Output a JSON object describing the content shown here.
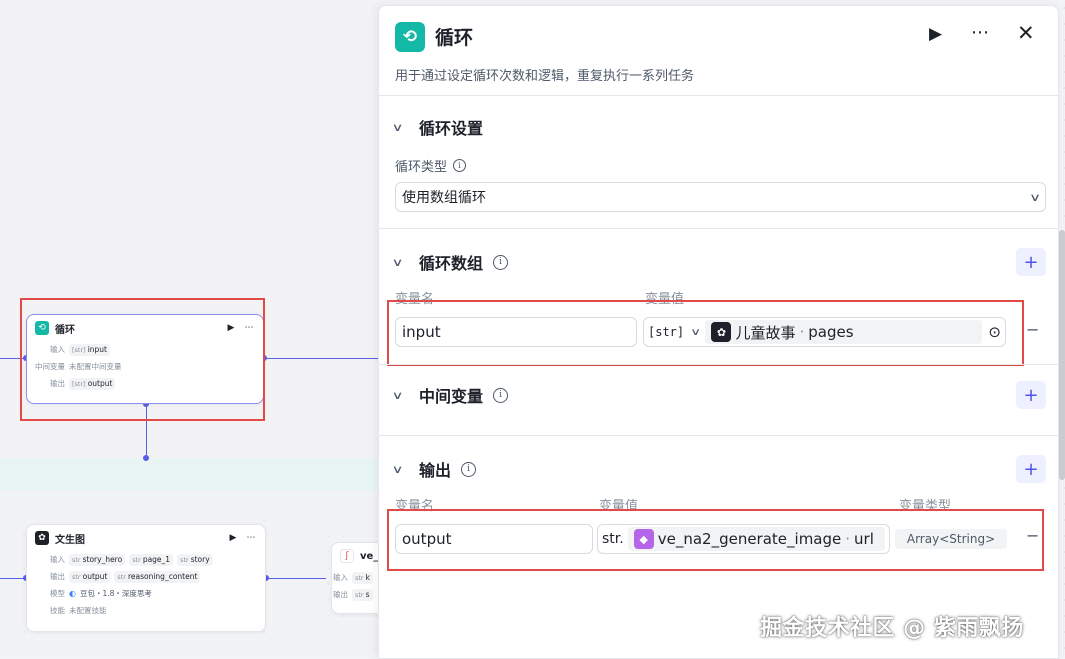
{
  "canvas": {
    "loop_node": {
      "title": "循环",
      "input_label": "输入",
      "input_type": "[str]",
      "input_value": "input",
      "mid_label": "中间变量",
      "mid_value": "未配置中间变量",
      "output_label": "输出",
      "output_type": "[str]",
      "output_value": "output"
    },
    "wenshengtu_node": {
      "title": "文生图",
      "input_label": "输入",
      "inputs": [
        "story_hero",
        "page_1",
        "story"
      ],
      "output_label": "输出",
      "outputs": [
        "output",
        "reasoning_content"
      ],
      "model_label": "模型",
      "model_value": "豆包・1.8・深度思考",
      "skill_label": "技能",
      "skill_value": "未配置技能"
    },
    "ve_node": {
      "title": "ve_",
      "input_label": "输入",
      "input_tag": "str",
      "input_value": "k",
      "output_label": "输出",
      "output_tag": "str",
      "output_value": "s"
    }
  },
  "panel": {
    "title": "循环",
    "description": "用于通过设定循环次数和逻辑，重复执行一系列任务",
    "loop_settings": {
      "title": "循环设置",
      "type_label": "循环类型",
      "type_value": "使用数组循环"
    },
    "loop_array": {
      "title": "循环数组",
      "col_name": "变量名",
      "col_value": "变量值",
      "var_name": "input",
      "type_badge": "[str]",
      "ref_node": "儿童故事",
      "ref_sep": "·",
      "ref_field": "pages"
    },
    "intermediate": {
      "title": "中间变量"
    },
    "output": {
      "title": "输出",
      "col_name": "变量名",
      "col_value": "变量值",
      "col_type": "变量类型",
      "var_name": "output",
      "type_badge": "str.",
      "ref_node": "ve_na2_generate_image",
      "ref_sep": "·",
      "ref_field": "url",
      "var_type": "Array<String>"
    }
  },
  "watermark": "掘金技术社区 @ 紫雨飘扬",
  "colors": {
    "accent": "#4d53e8",
    "loop_icon": "#14b8a6",
    "highlight": "#e24a4a",
    "edge": "#5b5fe8"
  }
}
